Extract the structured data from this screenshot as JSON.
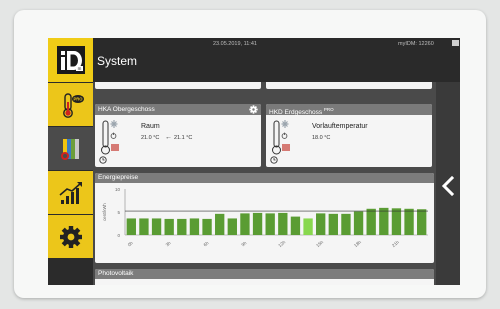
{
  "header": {
    "title": "System",
    "datetime": "23.05.2019, 11:41",
    "device": "myIDM: 12260"
  },
  "brand": {
    "logo_text": "iD",
    "logo_sub": "m"
  },
  "sidebar": {
    "items": [
      {
        "name": "heating-pro",
        "icon": "thermometer-pro-icon",
        "badge": "PRO"
      },
      {
        "name": "system",
        "icon": "system-icon",
        "active": true
      },
      {
        "name": "statistics",
        "icon": "chart-icon"
      },
      {
        "name": "settings",
        "icon": "gear-icon"
      }
    ]
  },
  "cards": [
    {
      "title": "HKA Obergeschoss",
      "badge": "",
      "label": "Raum",
      "value": "21.0 °C",
      "arrow": "←",
      "target": "21.1 °C"
    },
    {
      "title": "HKD Erdgeschoss",
      "badge": "PRO",
      "label": "Vorlauftemperatur",
      "value": "18.0 °C"
    }
  ],
  "energy": {
    "title": "Energiepreise",
    "ylabel": "cent/kWh"
  },
  "pv": {
    "title": "Photovoltaik"
  },
  "colors": {
    "accent": "#ecc61a",
    "bar": "#5a9c33",
    "bar_current": "#88d84e"
  },
  "chart_data": {
    "type": "bar",
    "ylabel": "cent/kWh",
    "ylim": [
      0,
      10
    ],
    "yticks": [
      0,
      5,
      10
    ],
    "threshold": 5.2,
    "x_tick_labels": [
      "0h",
      "3h",
      "6h",
      "9h",
      "12h",
      "15h",
      "18h",
      "21h"
    ],
    "current_index": 14,
    "values": [
      3.6,
      3.6,
      3.6,
      3.5,
      3.5,
      3.6,
      3.5,
      4.6,
      3.6,
      4.7,
      4.8,
      4.7,
      4.8,
      4.0,
      3.6,
      4.7,
      4.6,
      4.6,
      5.1,
      5.7,
      5.9,
      5.8,
      5.7,
      5.6
    ]
  }
}
